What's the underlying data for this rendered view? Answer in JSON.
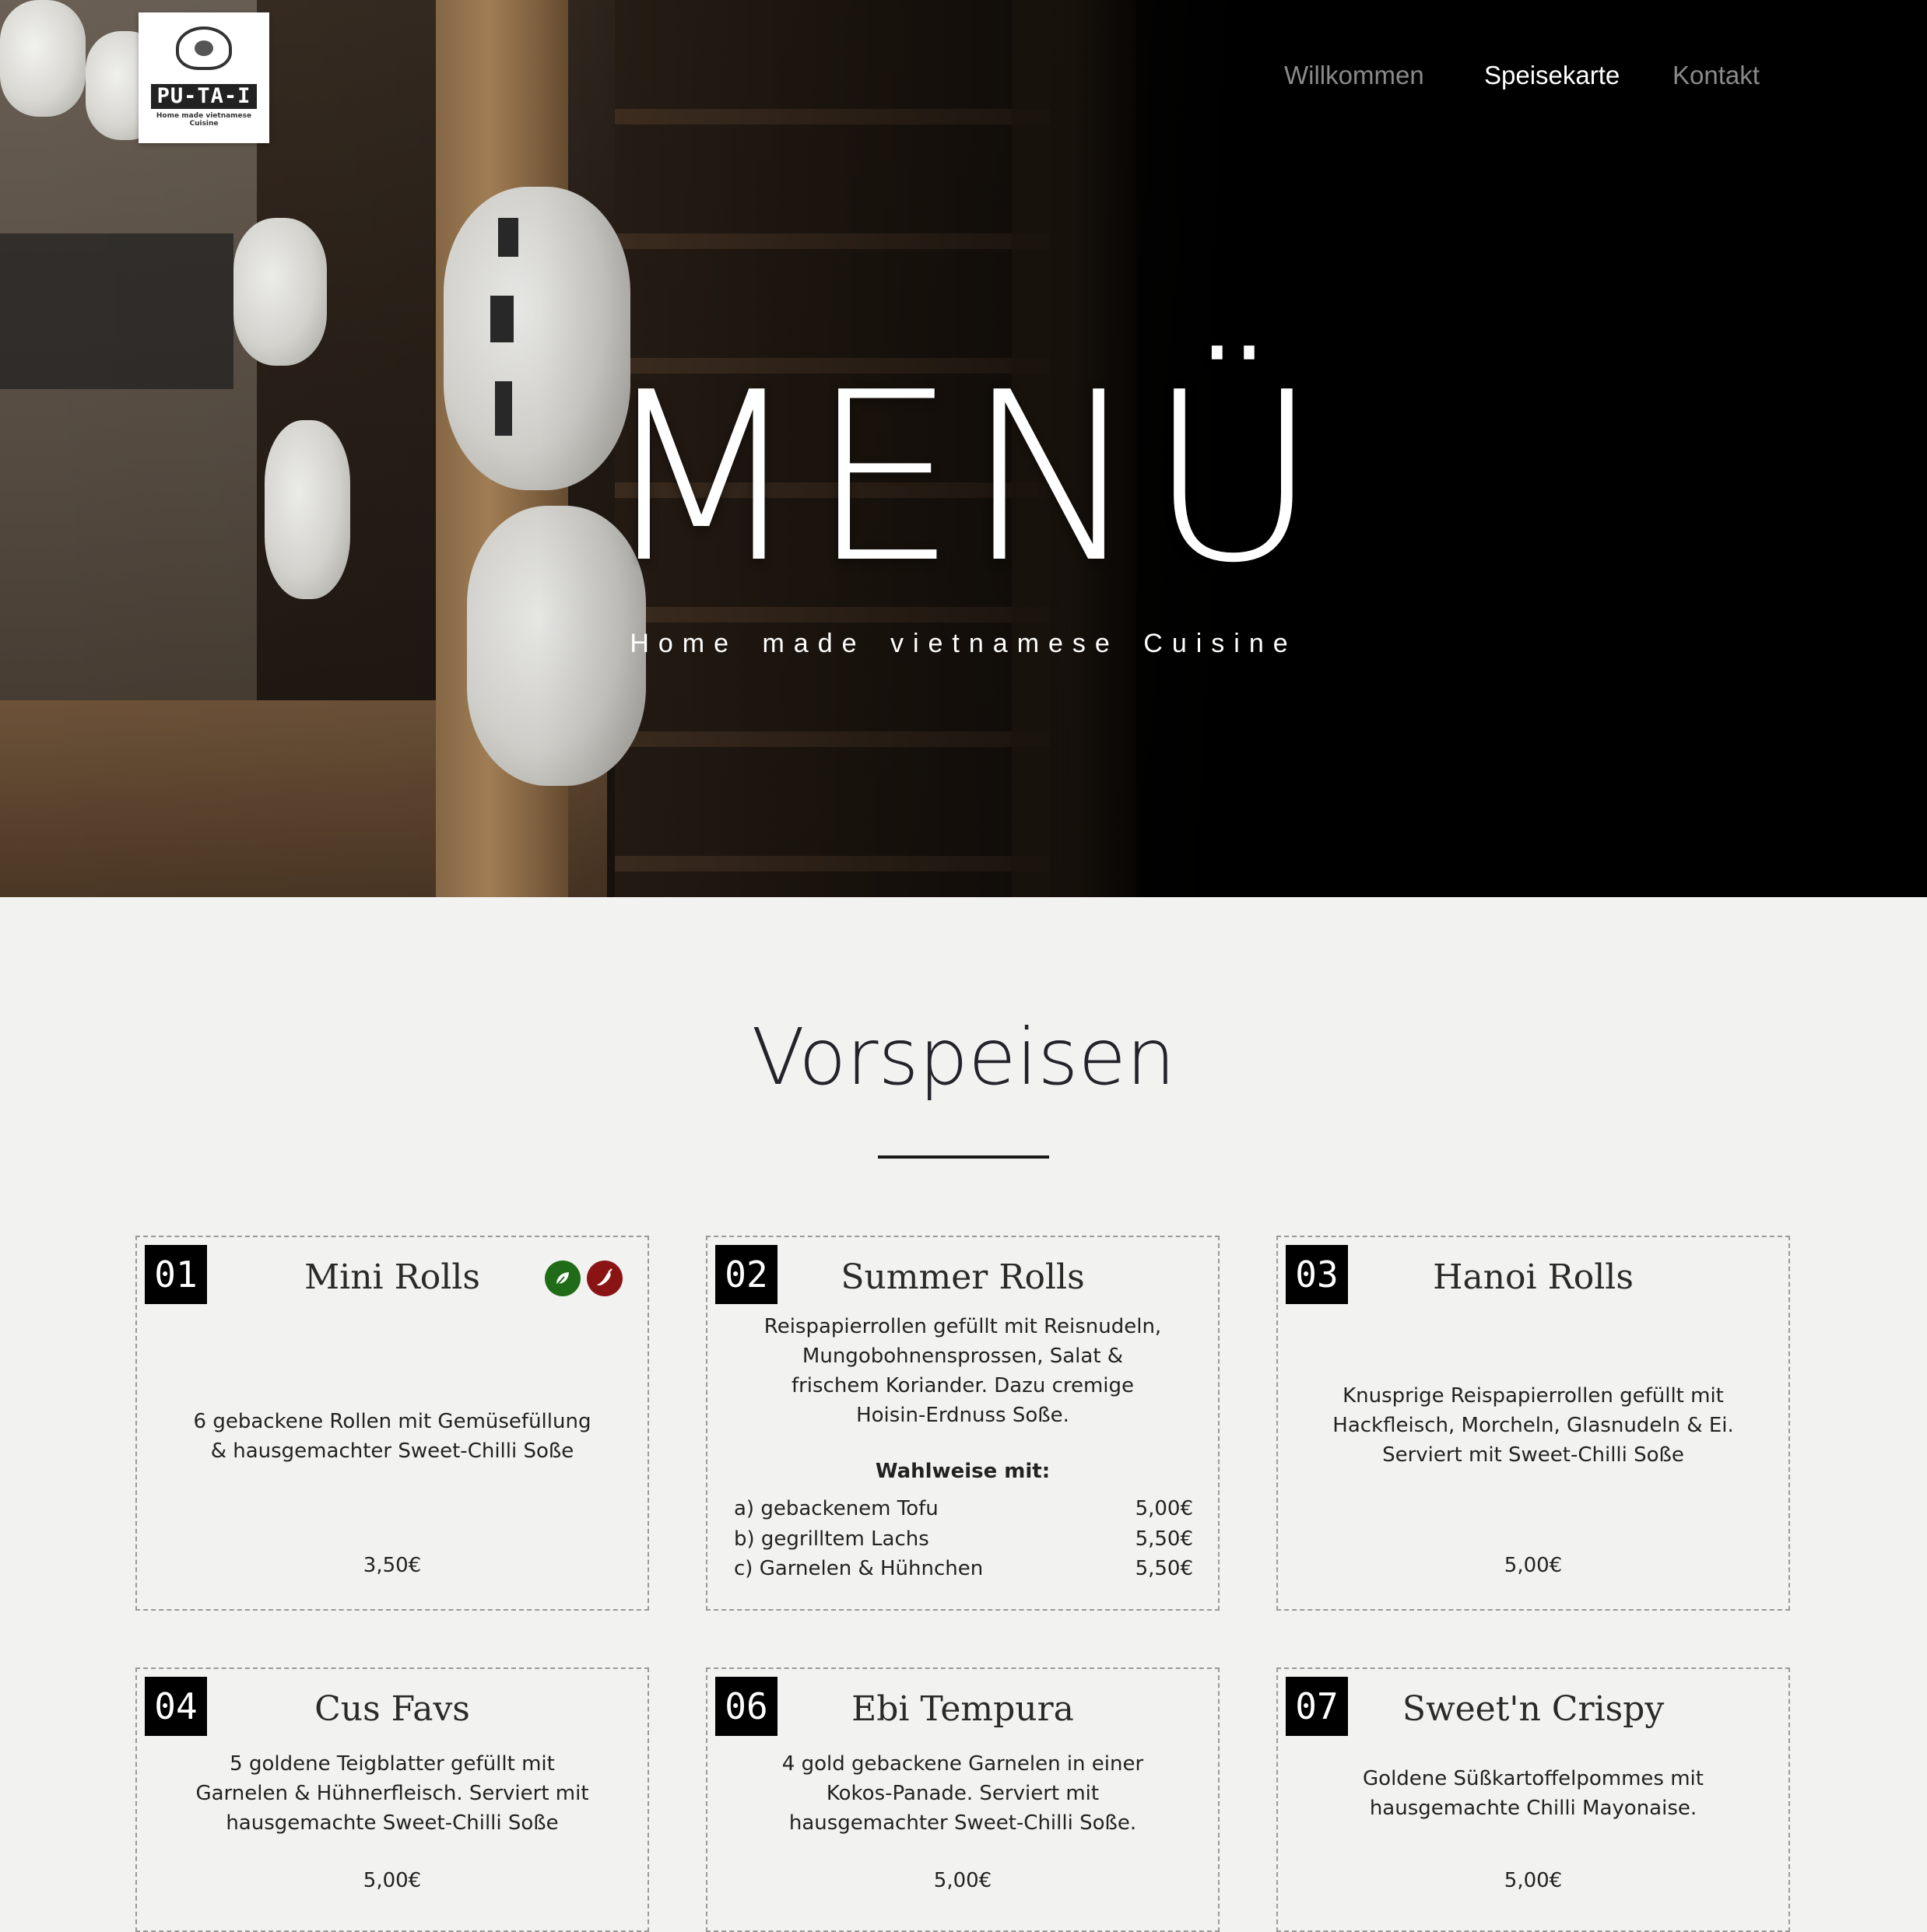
{
  "logo": {
    "brand": "PU-TA-I",
    "tagline": "Home made vietnamese Cuisine"
  },
  "nav": {
    "items": [
      "Willkommen",
      "Speisekarte",
      "Kontakt"
    ],
    "active": "Speisekarte"
  },
  "hero": {
    "title": "MENÜ",
    "subtitle": "Home made  vietnamese Cuisine"
  },
  "section": {
    "title": "Vorspeisen"
  },
  "colors": {
    "accent_dark": "#000000",
    "leaf_badge": "#1f6b18",
    "chili_badge": "#8a1414",
    "background": "#f2f2f1"
  },
  "cards": [
    {
      "number": "01",
      "name": "Mini Rolls",
      "description": "6 gebackene Rollen mit Gemüsefüllung & hausgemachter Sweet-Chilli Soße",
      "price": "3,50€",
      "icons": [
        "vegetarian-leaf-icon",
        "chili-icon"
      ]
    },
    {
      "number": "02",
      "name": "Summer Rolls",
      "description": "Reispapierrollen gefüllt mit Reisnudeln, Mungobohnensprossen, Salat & frischem Koriander. Dazu cremige Hoisin-Erdnuss Soße.",
      "options_heading": "Wahlweise mit:",
      "options": [
        {
          "label": "a) gebackenem Tofu",
          "price": "5,00€"
        },
        {
          "label": "b) gegrilltem Lachs",
          "price": "5,50€"
        },
        {
          "label": "c) Garnelen & Hühnchen",
          "price": "5,50€"
        }
      ]
    },
    {
      "number": "03",
      "name": "Hanoi Rolls",
      "description": "Knusprige Reispapierrollen gefüllt mit Hackfleisch, Morcheln, Glasnudeln & Ei. Serviert mit Sweet-Chilli Soße",
      "price": "5,00€"
    },
    {
      "number": "04",
      "name": "Cus Favs",
      "description": "5 goldene Teigblatter gefüllt mit Garnelen & Hühnerfleisch. Serviert mit hausgemachte Sweet-Chilli Soße",
      "price": "5,00€"
    },
    {
      "number": "06",
      "name": "Ebi Tempura",
      "description": "4 gold gebackene Garnelen in einer Kokos-Panade. Serviert mit hausgemachter Sweet-Chilli Soße.",
      "price": "5,00€"
    },
    {
      "number": "07",
      "name": "Sweet'n Crispy",
      "description": "Goldene Süßkartoffelpommes mit hausgemachte Chilli Mayonaise.",
      "price": "5,00€"
    }
  ]
}
